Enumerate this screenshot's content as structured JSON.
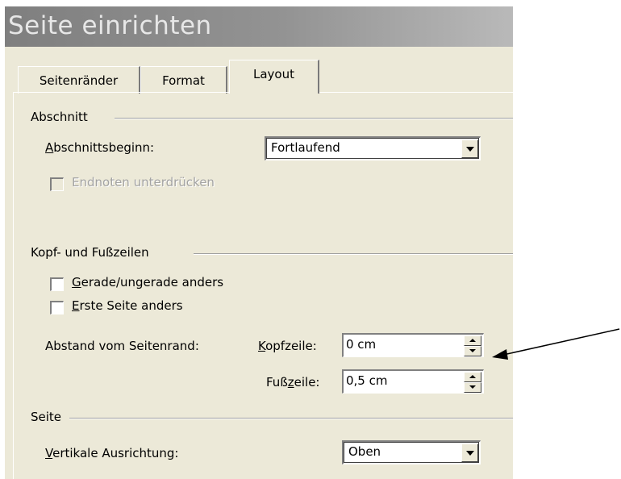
{
  "window": {
    "title": "Seite einrichten"
  },
  "tabs": [
    {
      "label": "Seitenränder"
    },
    {
      "label": "Format"
    },
    {
      "label": "Layout",
      "active": true
    }
  ],
  "abschnitt": {
    "group_label": "Abschnitt",
    "beginn_label_mnemonic": "A",
    "beginn_label_rest": "bschnittsbeginn:",
    "beginn_value": "Fortlaufend",
    "endnoten_label": "Endnoten unterdrücken",
    "endnoten_checked": false,
    "endnoten_enabled": false
  },
  "kopf_fuss": {
    "group_label": "Kopf- und Fußzeilen",
    "gerade_mnemonic": "G",
    "gerade_rest": "erade/ungerade anders",
    "gerade_checked": false,
    "erste_mnemonic": "E",
    "erste_rest": "rste Seite anders",
    "erste_checked": false,
    "abstand_label": "Abstand vom Seitenrand:",
    "kopfzeile_mnemonic": "K",
    "kopfzeile_rest": "opfzeile:",
    "kopfzeile_value": "0 cm",
    "fusszeile_pre": "Fuß",
    "fusszeile_mnemonic": "z",
    "fusszeile_rest": "eile:",
    "fusszeile_value": "0,5 cm"
  },
  "seite": {
    "group_label": "Seite",
    "vertikal_mnemonic": "V",
    "vertikal_rest": "ertikale Ausrichtung:",
    "vertikal_value": "Oben"
  },
  "annotation": {
    "arrow_color": "#000000"
  }
}
